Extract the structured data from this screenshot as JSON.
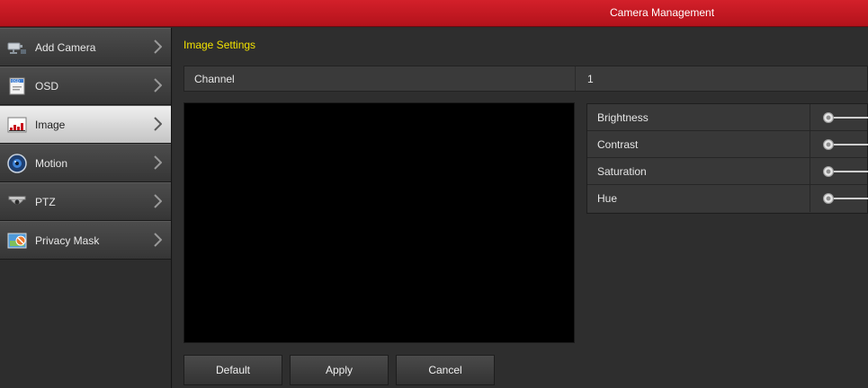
{
  "header": {
    "title": "Camera Management"
  },
  "sidebar": {
    "items": [
      {
        "label": "Add Camera",
        "icon": "camera-icon"
      },
      {
        "label": "OSD",
        "icon": "osd-icon"
      },
      {
        "label": "Image",
        "icon": "image-icon",
        "active": true
      },
      {
        "label": "Motion",
        "icon": "motion-icon"
      },
      {
        "label": "PTZ",
        "icon": "ptz-icon"
      },
      {
        "label": "Privacy Mask",
        "icon": "privacy-mask-icon"
      }
    ]
  },
  "main": {
    "section_title": "Image Settings",
    "channel": {
      "label": "Channel",
      "value": "1"
    },
    "adjustments": [
      {
        "label": "Brightness",
        "level": 0
      },
      {
        "label": "Contrast",
        "level": 0
      },
      {
        "label": "Saturation",
        "level": 0
      },
      {
        "label": "Hue",
        "level": 0
      }
    ],
    "buttons": {
      "default_label": "Default",
      "apply_label": "Apply",
      "cancel_label": "Cancel"
    }
  },
  "colors": {
    "header": "#c8161f",
    "section_title": "#f2e200",
    "background": "#2e2e2e"
  }
}
